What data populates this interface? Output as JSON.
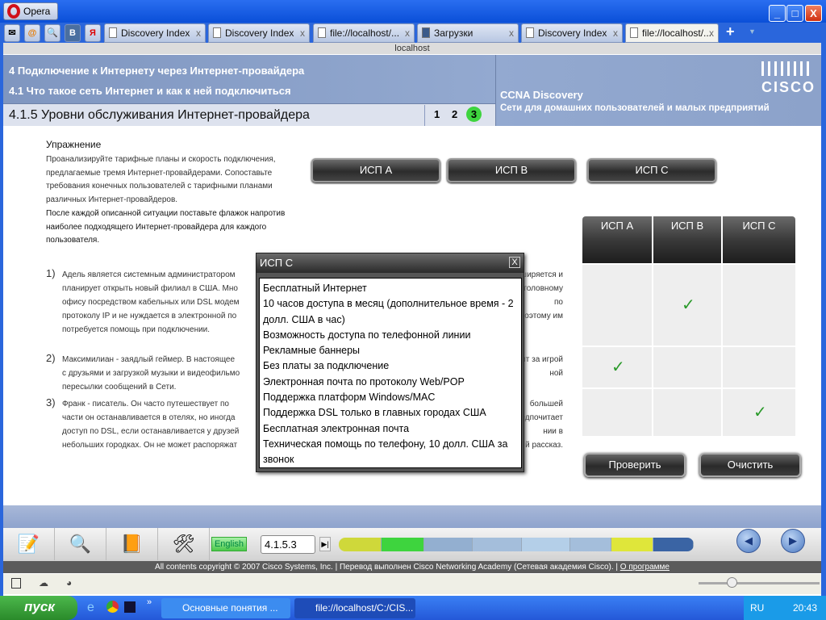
{
  "browser": {
    "menu_label": "Opera",
    "address": "localhost",
    "tabs": [
      {
        "label": "Discovery Index"
      },
      {
        "label": "Discovery Index"
      },
      {
        "label": "file://localhost/..."
      },
      {
        "label": "Загрузки"
      },
      {
        "label": "Discovery Index"
      },
      {
        "label": "file://localhost/..."
      }
    ],
    "quick": [
      "✉",
      "@",
      "🔍",
      "В",
      "Я"
    ]
  },
  "header": {
    "chapter": "4 Подключение к Интернету через Интернет-провайдера",
    "section": "4.1 Что такое сеть Интернет и как к ней подключиться",
    "course": "CCNA Discovery",
    "course_sub": "Сети для домашних пользователей и малых предприятий",
    "logo": "CISCO",
    "page_title": "4.1.5 Уровни обслуживания Интернет-провайдера",
    "pages": [
      "1",
      "2",
      "3"
    ]
  },
  "exercise": {
    "heading": "Упражнение",
    "intro": "Проанализируйте тарифные планы и скорость подключения, предлагаемые тремя Интернет-провайдерами. Сопоставьте требования конечных пользователей с тарифными планами различных Интернет-провайдеров.",
    "instruction": "После каждой описанной ситуации поставьте флажок напротив наиболее подходящего Интернет-провайдера для каждого пользователя.",
    "isp_buttons": [
      "ИСП A",
      "ИСП B",
      "ИСП C"
    ],
    "scenarios": [
      {
        "num": "1)",
        "lines": [
          [
            "Адель является системным администратором",
            "ширяется и"
          ],
          [
            "планирует открыть новый филиал в США. Мно",
            "головному"
          ],
          [
            "офису посредством кабельных или DSL модем",
            "по"
          ],
          [
            "протоколу IP и не нуждается в электронной по",
            "поэтому им"
          ],
          [
            "потребуется помощь при подключении.",
            ""
          ]
        ]
      },
      {
        "num": "2)",
        "lines": [
          [
            "Максимилиан - заядлый геймер. В настоящее",
            "дит за игрой"
          ],
          [
            "с друзьями и загрузкой музыки и видеофильмо",
            "ной"
          ],
          [
            "пересылки сообщений в Сети.",
            ""
          ]
        ]
      },
      {
        "num": "3)",
        "lines": [
          [
            "Франк - писатель. Он часто путешествует по",
            "большей"
          ],
          [
            "части он останавливается в отелях, но иногда",
            "редпочитает"
          ],
          [
            "доступ по DSL, если останавливается у друзей",
            "нии в"
          ],
          [
            "небольших городках. Он не может распоряжат",
            "й рассказ."
          ]
        ]
      }
    ],
    "table": {
      "headers": [
        "ИСП A",
        "ИСП B",
        "ИСП C"
      ],
      "checks": [
        1,
        0,
        2
      ],
      "check_mark": "✓"
    },
    "check_button": "Проверить",
    "clear_button": "Очистить"
  },
  "popup": {
    "title": "ИСП C",
    "close": "X",
    "items": [
      "Бесплатный Интернет",
      "10 часов доступа в месяц (дополнительное время - 2 долл. США в час)",
      "Возможность доступа по телефонной линии",
      "Рекламные баннеры",
      "Без платы за подключение",
      "Электронная почта по протоколу Web/POP",
      "Поддержка платформ Windows/MAC",
      "Поддержка DSL только в главных городах США",
      "Бесплатная электронная почта",
      "Техническая помощь по телефону, 10 долл. США за звонок"
    ]
  },
  "footer": {
    "language": "English",
    "page_field": "4.1.5.3",
    "copyright": "All contents copyright © 2007 Cisco Systems, Inc. | Перевод выполнен Cisco Networking Academy (Сетевая академия Cisco). | ",
    "about": "О программе",
    "progress_colors": [
      "#cfd83a",
      "#3ed43e",
      "#93afd0",
      "#a4bedb",
      "#b4cfe8",
      "#a4bedb",
      "#dfe63a",
      "#3a64a4"
    ]
  },
  "taskbar": {
    "start": "пуск",
    "tasks": [
      "Основные понятия ...",
      "file://localhost/C:/CIS..."
    ],
    "lang": "RU",
    "time": "20:43"
  }
}
